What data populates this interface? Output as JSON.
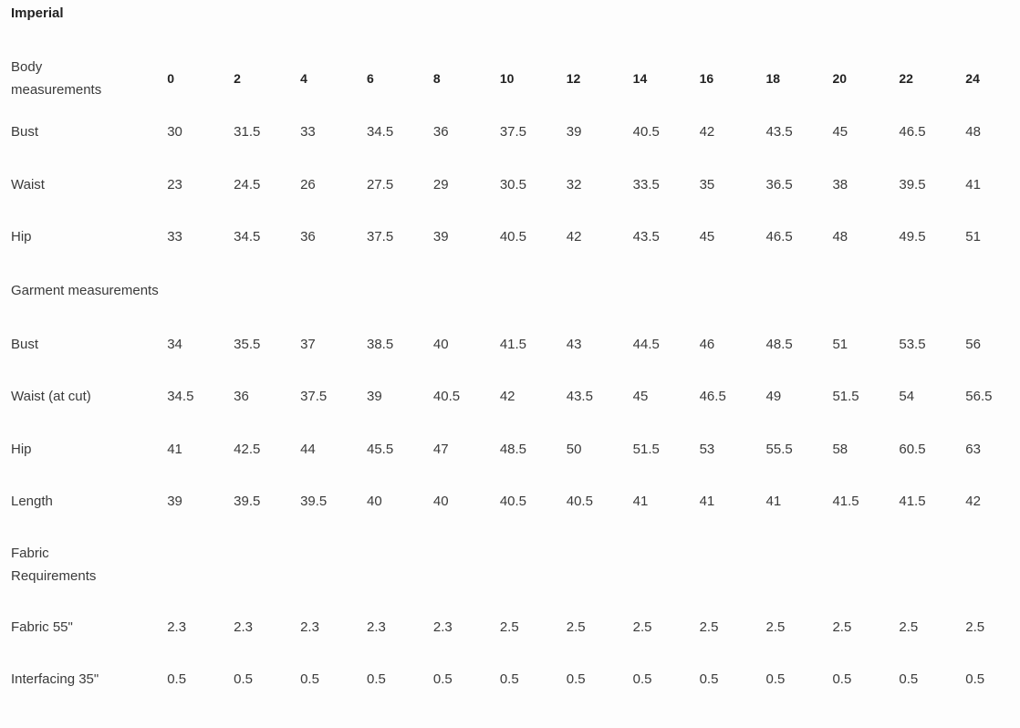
{
  "title": "Imperial",
  "sizes": [
    "0",
    "2",
    "4",
    "6",
    "8",
    "10",
    "12",
    "14",
    "16",
    "18",
    "20",
    "22",
    "24"
  ],
  "body_header": "Body measurements",
  "body_rows": [
    {
      "label": "Bust",
      "values": [
        "30",
        "31.5",
        "33",
        "34.5",
        "36",
        "37.5",
        "39",
        "40.5",
        "42",
        "43.5",
        "45",
        "46.5",
        "48"
      ]
    },
    {
      "label": "Waist",
      "values": [
        "23",
        "24.5",
        "26",
        "27.5",
        "29",
        "30.5",
        "32",
        "33.5",
        "35",
        "36.5",
        "38",
        "39.5",
        "41"
      ]
    },
    {
      "label": "Hip",
      "values": [
        "33",
        "34.5",
        "36",
        "37.5",
        "39",
        "40.5",
        "42",
        "43.5",
        "45",
        "46.5",
        "48",
        "49.5",
        "51"
      ]
    }
  ],
  "garment_header": "Garment measurements",
  "garment_rows": [
    {
      "label": "Bust",
      "values": [
        "34",
        "35.5",
        "37",
        "38.5",
        "40",
        "41.5",
        "43",
        "44.5",
        "46",
        "48.5",
        "51",
        "53.5",
        "56"
      ]
    },
    {
      "label": "Waist  (at cut)",
      "values": [
        "34.5",
        "36",
        "37.5",
        "39",
        "40.5",
        "42",
        "43.5",
        "45",
        "46.5",
        "49",
        "51.5",
        "54",
        "56.5"
      ]
    },
    {
      "label": "Hip",
      "values": [
        "41",
        "42.5",
        "44",
        "45.5",
        "47",
        "48.5",
        "50",
        "51.5",
        "53",
        "55.5",
        "58",
        "60.5",
        "63"
      ]
    },
    {
      "label": "Length",
      "values": [
        "39",
        "39.5",
        "39.5",
        "40",
        "40",
        "40.5",
        "40.5",
        "41",
        "41",
        "41",
        "41.5",
        "41.5",
        "42"
      ]
    }
  ],
  "fabric_header": "Fabric Requirements",
  "fabric_rows": [
    {
      "label": "Fabric 55\"",
      "values": [
        "2.3",
        "2.3",
        "2.3",
        "2.3",
        "2.3",
        "2.5",
        "2.5",
        "2.5",
        "2.5",
        "2.5",
        "2.5",
        "2.5",
        "2.5"
      ]
    },
    {
      "label": "Interfacing 35\"",
      "values": [
        "0.5",
        "0.5",
        "0.5",
        "0.5",
        "0.5",
        "0.5",
        "0.5",
        "0.5",
        "0.5",
        "0.5",
        "0.5",
        "0.5",
        "0.5"
      ]
    }
  ]
}
